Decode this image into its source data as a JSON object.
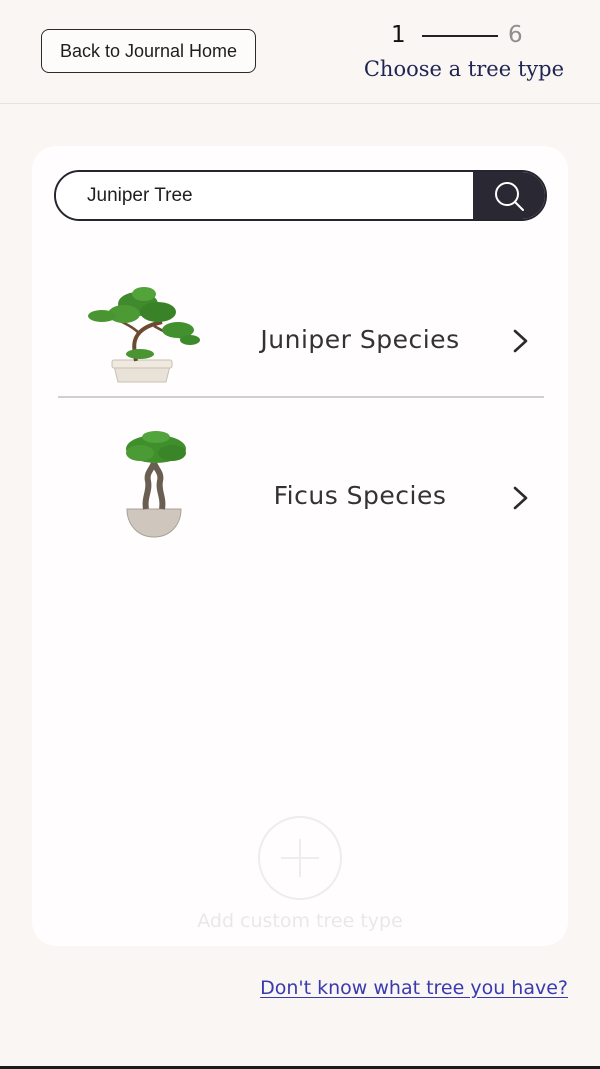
{
  "header": {
    "back_label": "Back to Journal Home",
    "progress": {
      "current_step": "1",
      "total_steps": "6"
    },
    "step_title": "Choose a tree type"
  },
  "search": {
    "value": "Juniper Tree",
    "icon": "search-icon"
  },
  "results": [
    {
      "label": "Juniper Species",
      "image": "juniper-bonsai-image",
      "icon": "chevron-right-icon"
    },
    {
      "label": "Ficus Species",
      "image": "ficus-bonsai-image",
      "icon": "chevron-right-icon"
    }
  ],
  "add_custom": {
    "label": "Add custom tree type",
    "icon": "plus-icon"
  },
  "help_link": "Don't know what tree you have?",
  "colors": {
    "background": "#f9f6f3",
    "card": "#fffdfe",
    "title": "#1f2452",
    "link": "#3a3ab0",
    "search_button": "#2a2833"
  }
}
